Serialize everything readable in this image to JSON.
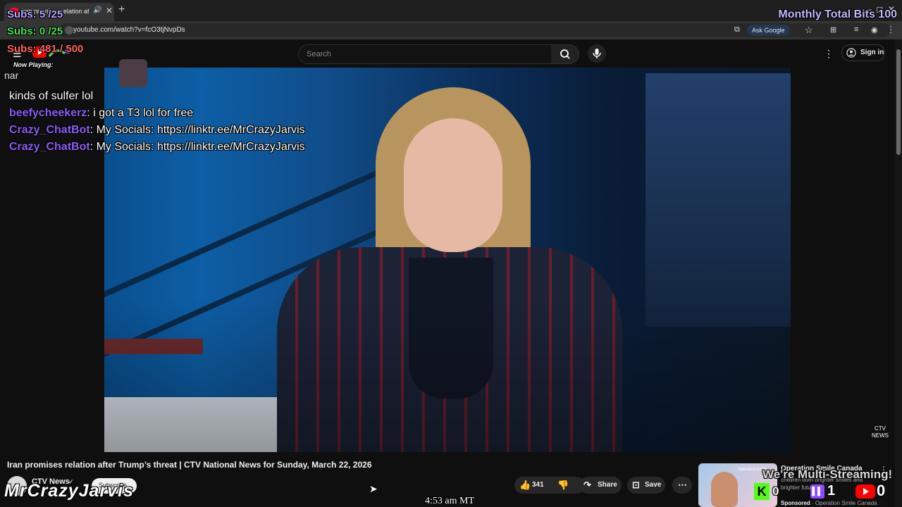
{
  "browser": {
    "tab_title": "Iran promises relation after",
    "url": "youtube.com/watch?v=fcO3tjNvpDs",
    "ask_google": "Ask Google"
  },
  "youtube": {
    "search_placeholder": "Search",
    "sign_in": "Sign in"
  },
  "overlay": {
    "subs_lines": [
      "Subs: 5 /25",
      "Subs: 0 /25",
      "Subs: 481 / 500"
    ],
    "monthly_bits": "Monthly Total Bits 100",
    "now_playing_label": "Now Playing:",
    "now_playing_song": "nar",
    "chat_partial": "kinds of sulfer lol",
    "chat": [
      {
        "user": "beefycheekerz",
        "message": ": i got a T3 lol for free"
      },
      {
        "user": "Crazy_ChatBot",
        "message": ": My Socials: https://linktr.ee/MrCrazyJarvis"
      },
      {
        "user": "Crazy_ChatBot",
        "message": ": My Socials: https://linktr.ee/MrCrazyJarvis"
      }
    ],
    "streamer_name": "MrCrazyJarvis",
    "timestamp": "4:53 am MT",
    "multistream_label": "We're Multi-Streaming!",
    "kick_count": "0",
    "twitch_count": "1",
    "youtube_count": "0"
  },
  "video": {
    "title": "Iran promises relation after Trump’s threat | CTV National News for Sunday, March 22, 2026",
    "channel": "CTV News",
    "subscribe_label": "Subscribe",
    "likes": "341",
    "share_label": "Share",
    "save_label": "Save",
    "watermark": "CTV NEWS"
  },
  "ad": {
    "title": "Operation Smile Canada",
    "description": "children born brighter smiles and brighter futures.",
    "sponsored_label": "Sponsored",
    "sponsor": "Operation Smile Canada",
    "thumb_label": "OperationSmile"
  },
  "colors": {
    "chat_user": "#8b5cf6",
    "subs_first": "#b7a5ff",
    "subs_second": "#46e05a",
    "subs_third": "#ff6060",
    "youtube_red": "#ff0000",
    "kick_green": "#53fc18",
    "twitch_purple": "#9146ff"
  }
}
